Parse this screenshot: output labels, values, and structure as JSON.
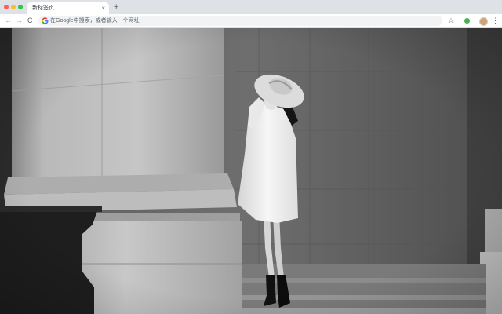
{
  "browser": {
    "tab_title": "新标签页",
    "tab_close_glyph": "×",
    "new_tab_glyph": "+",
    "omnibox_placeholder": "在Google中搜索，或者输入一个网址",
    "nav": {
      "back_glyph": "←",
      "forward_glyph": "→",
      "reload_glyph": "C"
    },
    "star_glyph": "☆",
    "menu_glyph": "⋮",
    "extension_color": "#4caf50"
  },
  "icons": {
    "google": "google-g-icon",
    "star": "bookmark-star-icon",
    "extension": "extension-icon",
    "avatar": "profile-avatar-icon",
    "menu": "kebab-menu-icon"
  }
}
